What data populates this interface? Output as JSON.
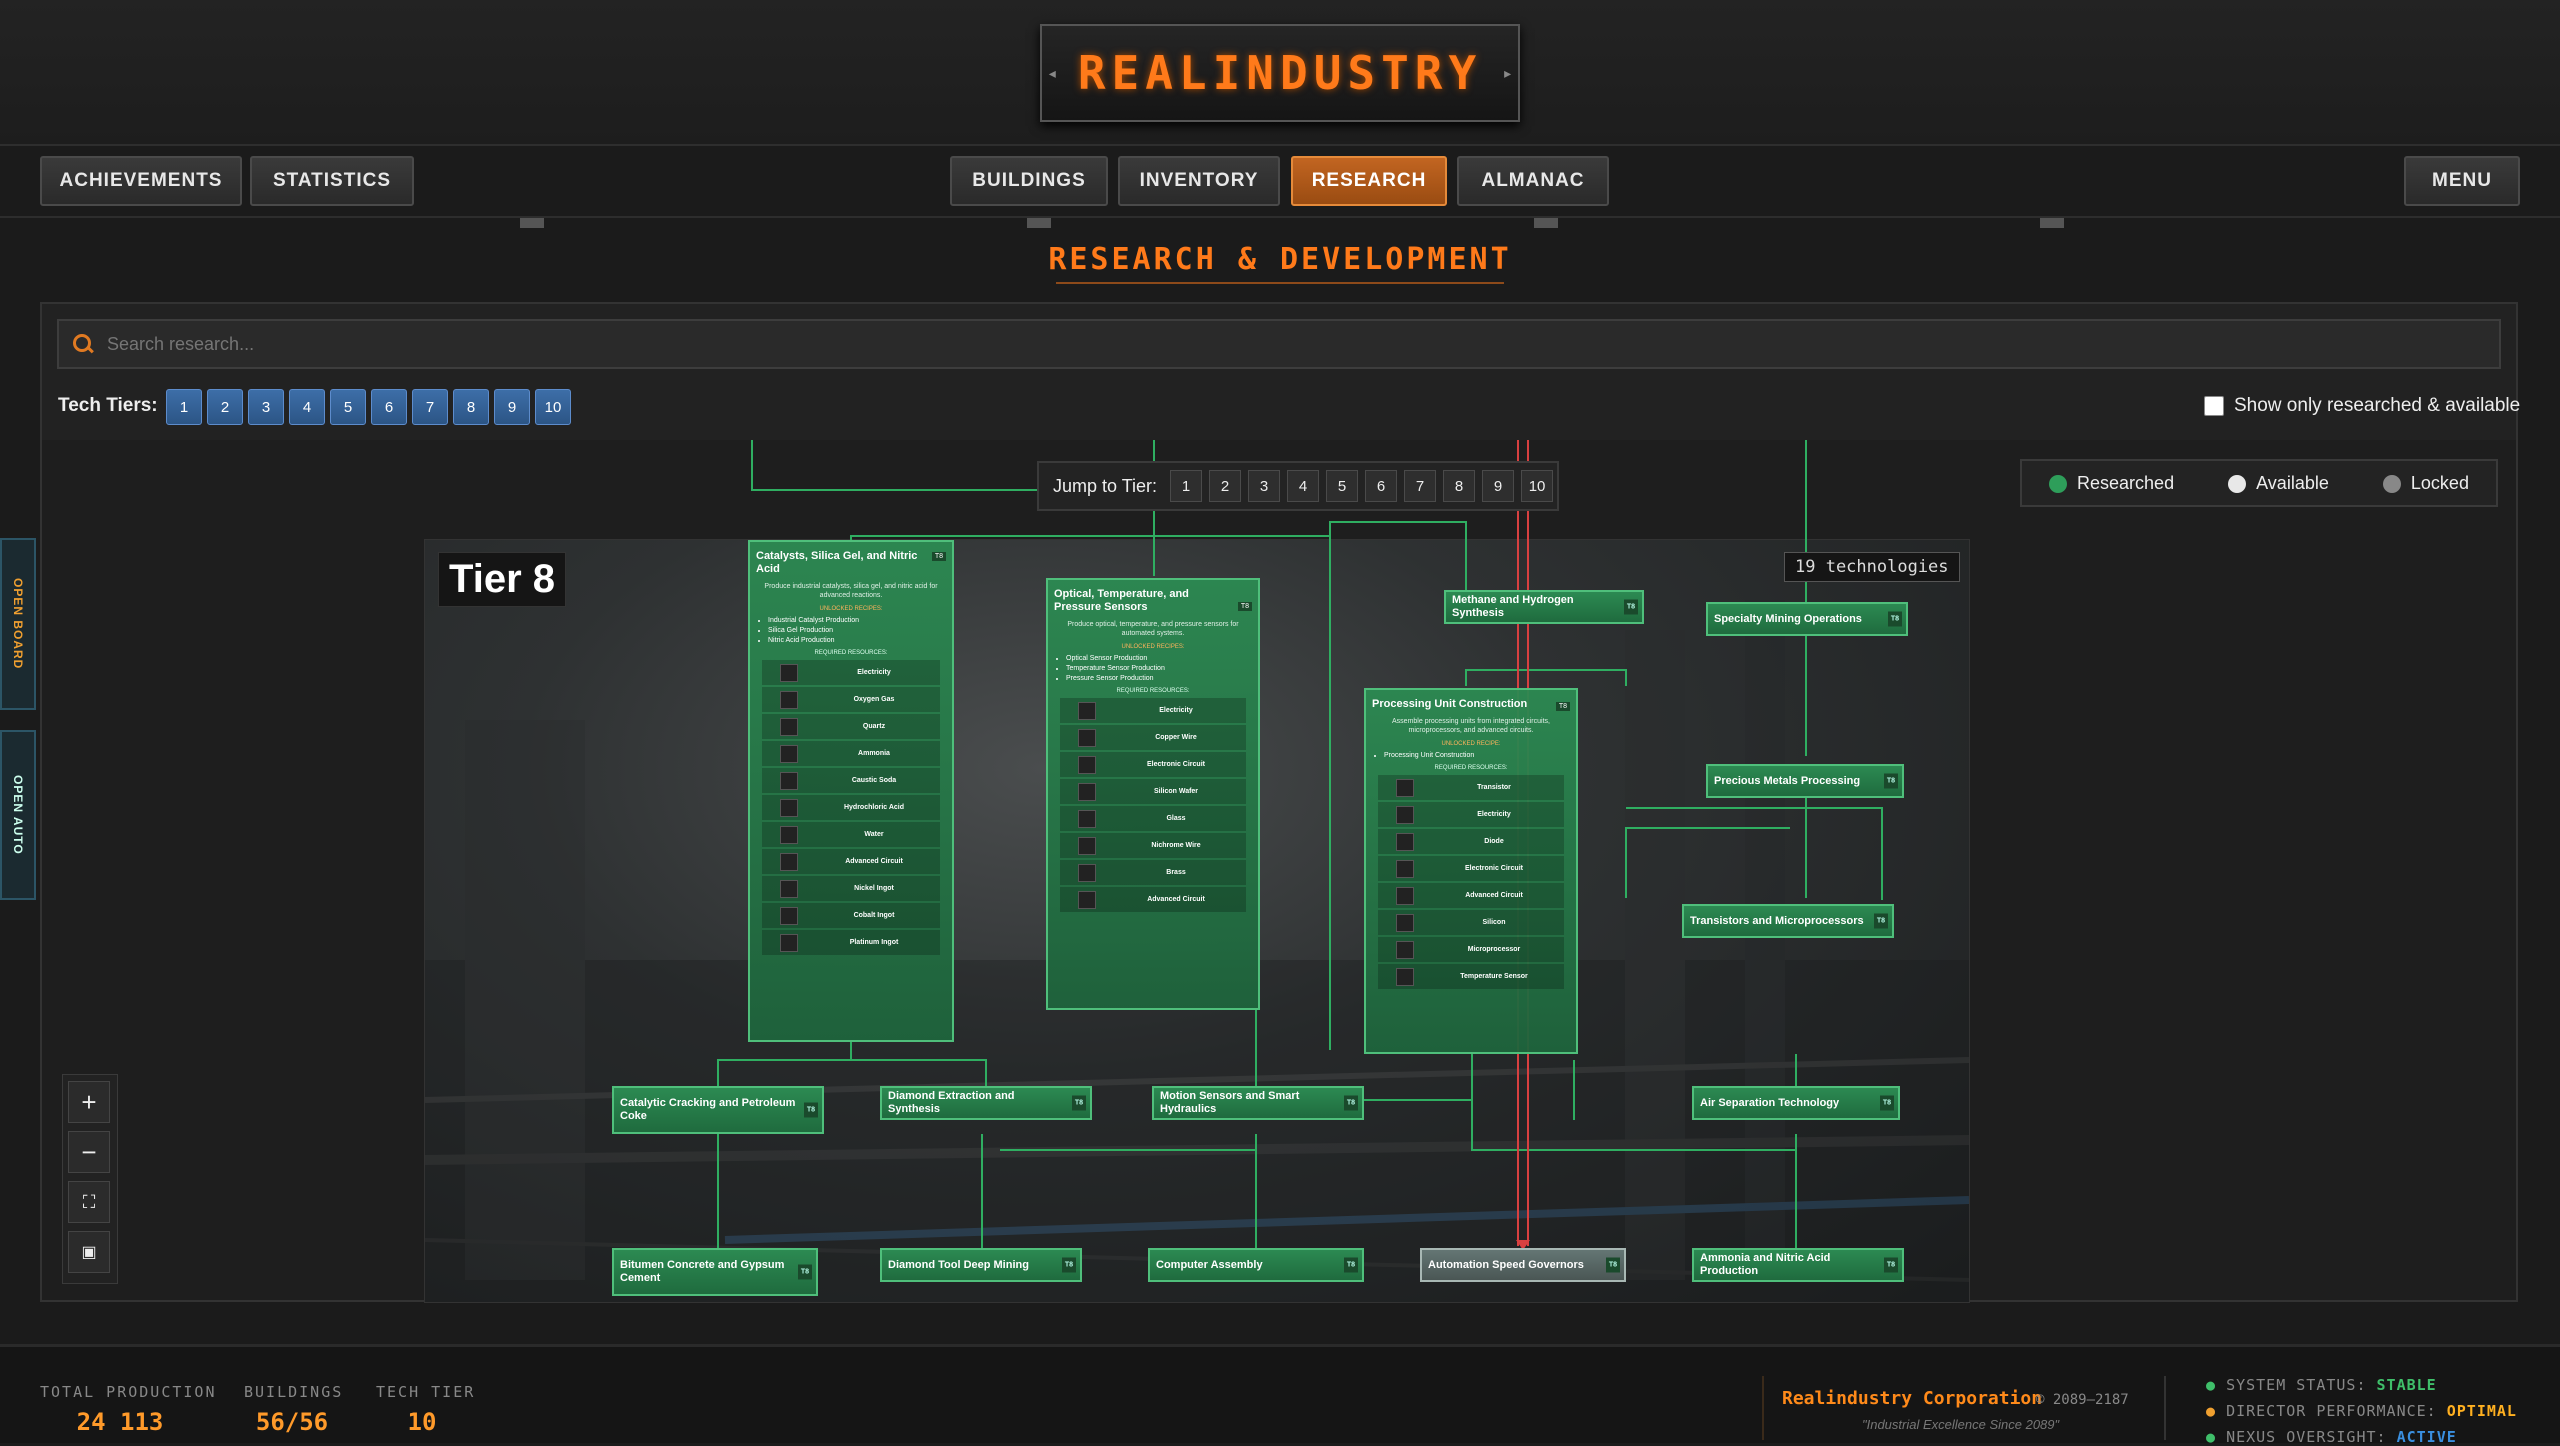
{
  "app": {
    "title": "REALINDUSTRY"
  },
  "nav": {
    "achievements": "ACHIEVEMENTS",
    "statistics": "STATISTICS",
    "buildings": "BUILDINGS",
    "inventory": "INVENTORY",
    "research": "RESEARCH",
    "almanac": "ALMANAC",
    "menu": "MENU"
  },
  "page": {
    "title": "RESEARCH & DEVELOPMENT"
  },
  "search": {
    "placeholder": "Search research..."
  },
  "tiers": {
    "label": "Tech Tiers:",
    "buttons": [
      "1",
      "2",
      "3",
      "4",
      "5",
      "6",
      "7",
      "8",
      "9",
      "10"
    ]
  },
  "filter": {
    "label": "Show only researched & available",
    "checked": false
  },
  "jump": {
    "label": "Jump to Tier:",
    "buttons": [
      "1",
      "2",
      "3",
      "4",
      "5",
      "6",
      "7",
      "8",
      "9",
      "10"
    ]
  },
  "legend": {
    "researched": "Researched",
    "available": "Available",
    "locked": "Locked",
    "colors": {
      "researched": "#2e9e5a",
      "available": "#e8e8e8",
      "locked": "#888888"
    }
  },
  "tier_section": {
    "label": "Tier 8",
    "count": "19 technologies"
  },
  "nodes": {
    "catalysts": {
      "title": "Catalysts, Silica Gel, and Nitric Acid",
      "desc": "Produce industrial catalysts, silica gel, and nitric acid for advanced reactions.",
      "unlocked": "UNLOCKED RECIPES:",
      "recipes": [
        "Industrial Catalyst Production",
        "Silica Gel Production",
        "Nitric Acid Production"
      ],
      "required": "REQUIRED RESOURCES:",
      "resources": [
        "Electricity",
        "Oxygen Gas",
        "Quartz",
        "Ammonia",
        "Caustic Soda",
        "Hydrochloric Acid",
        "Water",
        "Advanced Circuit",
        "Nickel Ingot",
        "Cobalt Ingot",
        "Platinum Ingot"
      ]
    },
    "optical": {
      "title": "Optical, Temperature, and Pressure Sensors",
      "desc": "Produce optical, temperature, and pressure sensors for automated systems.",
      "unlocked": "UNLOCKED RECIPES:",
      "recipes": [
        "Optical Sensor Production",
        "Temperature Sensor Production",
        "Pressure Sensor Production"
      ],
      "required": "REQUIRED RESOURCES:",
      "resources": [
        "Electricity",
        "Copper Wire",
        "Electronic Circuit",
        "Silicon Wafer",
        "Glass",
        "Nichrome Wire",
        "Brass",
        "Advanced Circuit"
      ]
    },
    "processing": {
      "title": "Processing Unit Construction",
      "desc": "Assemble processing units from integrated circuits, microprocessors, and advanced circuits.",
      "unlocked": "UNLOCKED RECIPE:",
      "recipes": [
        "Processing Unit Construction"
      ],
      "required": "REQUIRED RESOURCES:",
      "resources": [
        "Transistor",
        "Electricity",
        "Diode",
        "Electronic Circuit",
        "Advanced Circuit",
        "Silicon",
        "Microprocessor",
        "Temperature Sensor"
      ]
    },
    "methane": "Methane and Hydrogen Synthesis",
    "specialty": "Specialty Mining Operations",
    "precious": "Precious Metals Processing",
    "transistors": "Transistors and Microprocessors",
    "catalytic": "Catalytic Cracking and Petroleum Coke",
    "diamond_ext": "Diamond Extraction and Synthesis",
    "motion": "Motion Sensors and Smart Hydraulics",
    "air": "Air Separation Technology",
    "bitumen": "Bitumen Concrete and Gypsum Cement",
    "diamond_tool": "Diamond Tool Deep Mining",
    "computer": "Computer Assembly",
    "automation": "Automation Speed Governors",
    "ammonia": "Ammonia and Nitric Acid Production",
    "tier_tag": "T8"
  },
  "side": {
    "board": "OPEN BOARD",
    "auto": "OPEN AUTO"
  },
  "footer": {
    "total_production_label": "TOTAL PRODUCTION",
    "total_production": "24 113",
    "buildings_label": "BUILDINGS",
    "buildings": "56/56",
    "tech_tier_label": "TECH TIER",
    "tech_tier": "10",
    "company": "Realindustry Corporation",
    "years": "© 2089–2187",
    "tagline": "\"Industrial Excellence Since 2089\"",
    "status_label": "SYSTEM STATUS:",
    "status": "STABLE",
    "director_label": "DIRECTOR PERFORMANCE:",
    "director": "OPTIMAL",
    "nexus_label": "NEXUS OVERSIGHT:",
    "nexus": "ACTIVE"
  }
}
